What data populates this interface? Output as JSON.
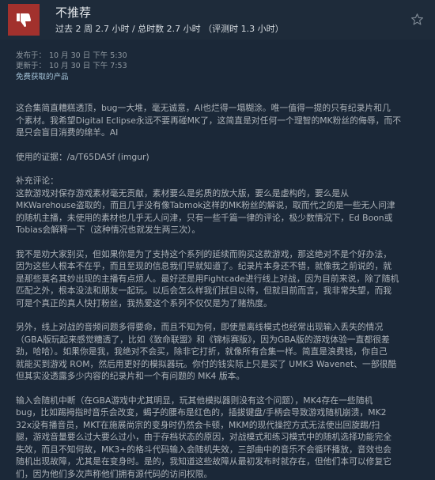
{
  "review": {
    "verdict": "不推荐",
    "hours": "过去 2 周 2.7 小时 / 总时数 2.7 小时 （评测时 1.3 小时）",
    "posted_label": "发布于：",
    "posted_date": "10 月 30 日 下午 5:30",
    "updated_label": "更新于：",
    "updated_date": "10 月 30 日 下午 7:53",
    "free_product": "免费获取的产品",
    "paragraphs": [
      "这合集简直糟糕透顶，bug一大堆，毫无诚意，AI也烂得一塌糊涂。唯一值得一提的只有纪录片和几\n个素材。我希望Digital Eclipse永远不要再碰MK了，这简直是对任何一个理智的MK粉丝的侮辱，而不\n是只会盲目消费的绵羊。AI",
      "使用的证据：/a/T65DA5f (imgur)",
      "补充评论：\n这款游戏对保存游戏素材毫无贡献，素材要么是劣质的放大版，要么是虚构的，要么是从\nMKWarehouse盗取的，而且几乎没有像Tabmok这样的MK粉丝的解说，取而代之的是一些无人问津\n的随机主播，未使用的素材也几乎无人问津，只有一些千篇一律的评论，极少数情况下，Ed Boon或\nTobias会解释一下（这种情况也就发生两三次）。",
      "我不是劝大家别买，但如果你是为了支持这个系列的延续而购买这款游戏，那这绝对不是个好办法，\n因为这些人根本不在乎，而且至现的信息我们早就知道了。纪录片本身还不错，就像我之前说的，就\n是那些莫名其妙出现的主播有点烦人。最好还是用Fightcade进行线上对战，因为目前来说，除了随机\n匹配之外，根本没法和朋友一起玩。以后会怎么样我们拭目以待，但就目前而言，我非常失望，而我\n可是个真正的真人快打粉丝，我热爱这个系列不仅仅是为了赌热度。",
      "另外，线上对战的音频问题多得要命，而且不知为何，即使是离线模式也经常出现输入丢失的情况\n（GBA版玩起来感觉糟透了，比如《致命联盟》和《锦标赛版》，因为GBA版的游戏体验一直都很差\n劲，哈哈）。如果你是我，我绝对不会买，除非它打折，就像所有合集一样。简直是浪费钱，你自己\n就能买到游戏 ROM，然后用更好的模拟器玩。你付的钱实际上只是买了 UMK3 Wavenet、一部很酷\n但其实没透露多少内容的纪录片和一个有问题的 MK4 版本。",
      "输入会随机中断（在GBA游戏中尤其明显，玩其他模拟器则没有这个问题），MK4存在一些随机\nbug，比如踢拇指时音乐会改变，蝎子的腰布是红色的，插拔键盘/手柄会导致游戏随机崩溃，MK2\n32x没有播音员，MKT在施展尚宗的变身时仍然会卡顿，MKM的现代操控方式无法使出回旋踢/扫\n腿，游戏音量要么过大要么过小，由于存档状态的原因，对战模式和练习模式中的随机选择功能完全\n失效，而且不知何故，MK3+的格斗代码输入会随机失效，三部曲中的音乐不会循环播放，音效也会\n随机出现故障，尤其是在变身时。是的，我知道这些故障从最初发布时就存在，但他们本可以修复它\n们，因为他们多次声称他们拥有源代码的访问权限。"
    ]
  },
  "colors": {
    "background": "#1b2838",
    "header": "#1e2b3a",
    "thumb_down_bg": "#a2312d",
    "text": "#acb2b8",
    "link_blue": "#a6c4d9"
  },
  "icons": {
    "verdict_icon": "thumbs-down-icon",
    "award_icon": "star-icon"
  }
}
